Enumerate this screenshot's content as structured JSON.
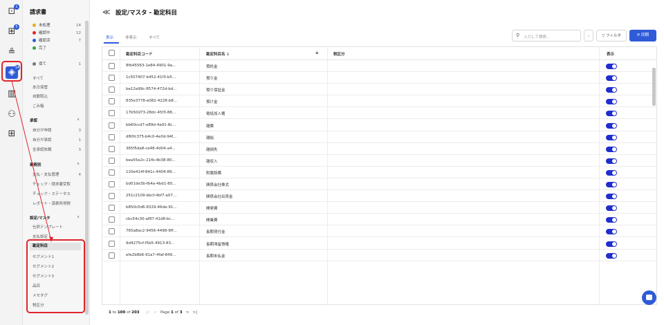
{
  "rail": {
    "badges": [
      "1",
      "5",
      "14"
    ]
  },
  "sidebar": {
    "title": "請求書",
    "statuses": [
      {
        "label": "未処理",
        "count": "14",
        "color": "#e0b020"
      },
      {
        "label": "確認中",
        "count": "12",
        "color": "#e0242b"
      },
      {
        "label": "確認済",
        "count": "7",
        "color": "#2f5bd8"
      },
      {
        "label": "完了",
        "count": "",
        "color": "#2ea84a"
      },
      {
        "label": "保て",
        "count": "1",
        "color": "#777777"
      }
    ],
    "links1": [
      "すべて",
      "本日保管",
      "自動取込",
      "ごみ箱"
    ],
    "approval": {
      "title": "承認",
      "items": [
        {
          "label": "自分が申請",
          "count": "3"
        },
        {
          "label": "自分が承認",
          "count": "1"
        },
        {
          "label": "全承認依頼",
          "count": "3"
        }
      ]
    },
    "business": {
      "title": "業務別",
      "items": [
        {
          "label": "支払・支払管理",
          "count": "4"
        },
        {
          "label": "チェック・請求書受取",
          "count": ""
        },
        {
          "label": "チェック・ステータス",
          "count": ""
        },
        {
          "label": "レポート・源泉所得税",
          "count": ""
        }
      ]
    },
    "settings": {
      "title": "設定/マスタ",
      "items": [
        "仕訳テンプレート",
        "支払設定",
        "勘定科目",
        "セグメント1",
        "セグメント2",
        "セグメント3",
        "品目",
        "メモタグ",
        "税区分"
      ]
    }
  },
  "header": {
    "back": "≪",
    "title": "設定/マスタ - 勘定科目"
  },
  "tabs": [
    "表示",
    "非表示",
    "すべて"
  ],
  "search": {
    "placeholder": "入力して検索..."
  },
  "buttons": {
    "filter": "▽ フィルタ",
    "sync": "⟳ 同期"
  },
  "table": {
    "columns": {
      "code": "勘定科目コード",
      "name": "勘定科目名 ↓",
      "tax": "税区分",
      "display": "表示"
    },
    "rows": [
      {
        "code": "8fb45563-1e84-4901-9a...",
        "name": "預託金"
      },
      {
        "code": "1c507407-b452-41f3-b5...",
        "name": "預り金"
      },
      {
        "code": "be12a99c-8574-472d-bd...",
        "name": "預り保証金"
      },
      {
        "code": "835e3778-e082-4228-b8...",
        "name": "預け金"
      },
      {
        "code": "17b50d73-28dc-45f3-88...",
        "name": "電話加入権"
      },
      {
        "code": "bb60ccd7-e89d-4a91-8c...",
        "name": "雑費"
      },
      {
        "code": "d80fc375-b4c0-4e0d-94f...",
        "name": "雑給"
      },
      {
        "code": "365f5da8-ce48-4d04-a4...",
        "name": "雑損失"
      },
      {
        "code": "bea55e2c-21fb-4b38-80...",
        "name": "雑収入"
      },
      {
        "code": "120e414f-841c-4404-89...",
        "name": "附属設備"
      },
      {
        "code": "bd01de3b-fb4a-4bd1-80...",
        "name": "関係会社株式"
      },
      {
        "code": "251c2109-bbcf-4bf7-a07...",
        "name": "関係会社出資金"
      },
      {
        "code": "b850c0d6-8329-46de-91...",
        "name": "開発費"
      },
      {
        "code": "cbc54c30-af87-41d8-bc...",
        "name": "開業費"
      },
      {
        "code": "765a8ac2-9456-4498-9ff...",
        "name": "長期貸付金"
      },
      {
        "code": "9d4275cf-f5b5-4913-83...",
        "name": "長期滞留債権"
      },
      {
        "code": "efe2b8b6-91a7-4faf-849...",
        "name": "長期未払金"
      }
    ]
  },
  "pager": {
    "from": "1",
    "to_label": "to",
    "to": "100",
    "of_label": "of",
    "total": "203",
    "first": "|<",
    "prev": "<",
    "page_label": "Page",
    "page": "1",
    "of2": "of",
    "pages": "3",
    "next": ">",
    "last": ">|"
  }
}
